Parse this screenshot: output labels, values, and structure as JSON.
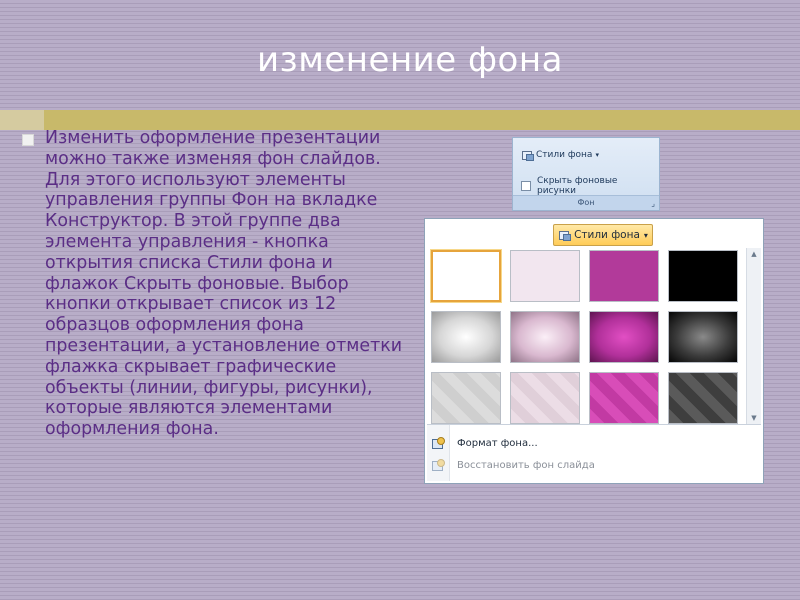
{
  "slide": {
    "title": "изменение фона",
    "body": "Изменить оформление презентации можно также изменяя фон слайдов. Для этого используют элементы управления группы Фон на вкладке Конструктор. В этой группе два элемента управления - кнопка открытия списка Стили фона и флажок Скрыть фоновые. Выбор кнопки открывает список из 12 образцов оформления фона презентации, а установление отметки флажка скрывает графические объекты (линии, фигуры, рисунки), которые являются элементами оформления фона."
  },
  "ribbon": {
    "styles_button": "Стили фона",
    "dropdown_arrow": "▾",
    "hide_checkbox_label": "Скрыть фоновые рисунки",
    "group_label": "Фон",
    "launcher": "⌟"
  },
  "gallery": {
    "button_label": "Стили фона",
    "dropdown_arrow": "▾",
    "format_item": "Формат фона...",
    "reset_item": "Восстановить фон слайда",
    "scroll_up": "▲",
    "scroll_down": "▼"
  },
  "colors": {
    "title_text": "#ffffff",
    "body_text": "#5b2e86",
    "title_bar": "#c8b96a",
    "selection": "#e6a43c"
  }
}
